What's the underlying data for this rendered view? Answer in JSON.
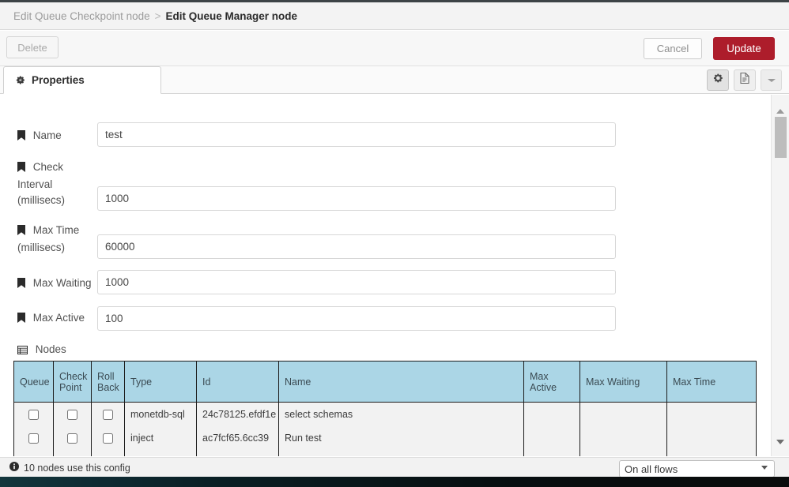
{
  "breadcrumb": {
    "previous": "Edit Queue Checkpoint node",
    "separator": ">",
    "current": "Edit Queue Manager node"
  },
  "toolbar": {
    "delete_label": "Delete",
    "cancel_label": "Cancel",
    "update_label": "Update",
    "update_color": "#ad1d2b"
  },
  "tabs": {
    "properties_label": "Properties",
    "gear_icon": "gear-icon",
    "doc_icon": "document-icon",
    "caret_icon": "chevron-down-icon"
  },
  "form": {
    "fields": [
      {
        "label": "Name",
        "value": "test",
        "icon": "tag-icon"
      },
      {
        "label": "Check Interval (millisecs)",
        "value": "1000",
        "icon": "tag-icon"
      },
      {
        "label": "Max Time (millisecs)",
        "value": "60000",
        "icon": "tag-icon"
      },
      {
        "label": "Max Waiting",
        "value": "1000",
        "icon": "tag-icon"
      },
      {
        "label": "Max Active",
        "value": "100",
        "icon": "tag-icon"
      }
    ],
    "field_labels": {
      "name": "Name",
      "check_interval_l1": "Check",
      "check_interval_l2": "Interval",
      "check_interval_l3": "(millisecs)",
      "max_time_l1": "Max Time",
      "max_time_l2": "(millisecs)",
      "max_waiting": "Max Waiting",
      "max_active": "Max Active"
    },
    "values": {
      "name": "test",
      "check_interval": "1000",
      "max_time": "60000",
      "max_waiting": "1000",
      "max_active": "100"
    }
  },
  "nodes": {
    "section_label": "Nodes",
    "section_icon": "table-list-icon",
    "header_color": "#abd6e6",
    "columns": [
      "Queue",
      "Check Point",
      "Roll Back",
      "Type",
      "Id",
      "Name",
      "Max Active",
      "Max Waiting",
      "Max Time"
    ],
    "column_headers": {
      "queue": "Queue",
      "check_point_l1": "Check",
      "check_point_l2": "Point",
      "roll_back_l1": "Roll",
      "roll_back_l2": "Back",
      "type": "Type",
      "id": "Id",
      "name": "Name",
      "max_active": "Max Active",
      "max_waiting": "Max Waiting",
      "max_time": "Max Time"
    },
    "rows": [
      {
        "queue": false,
        "check_point": false,
        "roll_back": false,
        "type": "monetdb-sql",
        "id": "24c78125.efdf1e",
        "name": "select schemas",
        "max_active": "",
        "max_waiting": "",
        "max_time": ""
      },
      {
        "queue": false,
        "check_point": false,
        "roll_back": false,
        "type": "inject",
        "id": "ac7fcf65.6cc39",
        "name": "Run test",
        "max_active": "",
        "max_waiting": "",
        "max_time": ""
      }
    ]
  },
  "footer": {
    "info_icon": "info-icon",
    "info_text": "10 nodes use this config",
    "scope_selected": "On all flows",
    "scope_options": [
      "On all flows"
    ]
  }
}
